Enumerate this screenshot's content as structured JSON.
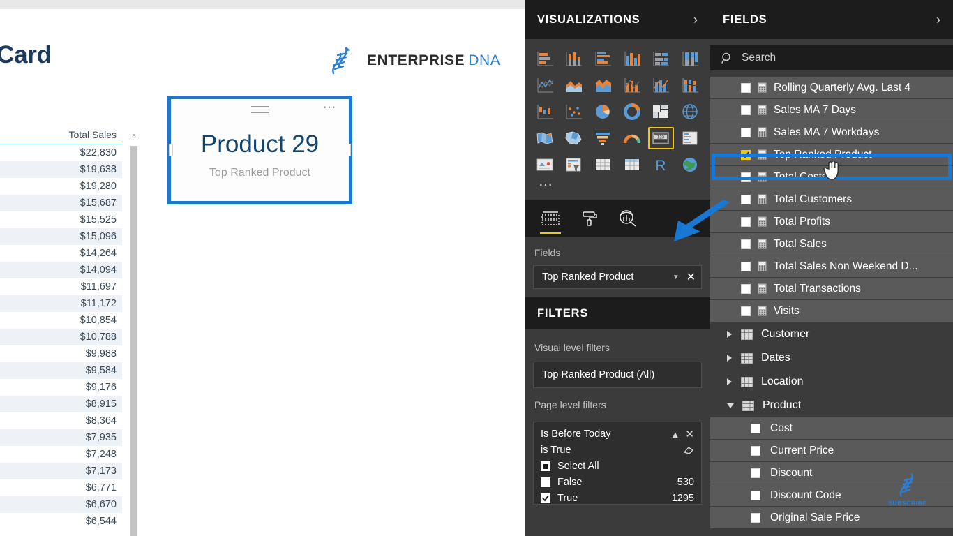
{
  "report": {
    "title": "A Card",
    "logo": {
      "primary": "ENTERPRISE",
      "secondary": "DNA",
      "icon": "dna-helix-icon"
    },
    "card_visual": {
      "value": "Product 29",
      "label": "Top Ranked Product",
      "focus_icon": "focus-mode-icon",
      "more_icon": "more-options-ellipsis-icon",
      "selected": true,
      "selection_color": "#1878d4"
    },
    "sales_table": {
      "header": "Total Sales",
      "values": [
        "$22,830",
        "$19,638",
        "$19,280",
        "$15,687",
        "$15,525",
        "$15,096",
        "$14,264",
        "$14,094",
        "$11,697",
        "$11,172",
        "$10,854",
        "$10,788",
        "$9,988",
        "$9,584",
        "$9,176",
        "$8,915",
        "$8,364",
        "$7,935",
        "$7,248",
        "$7,173",
        "$6,771",
        "$6,670",
        "$6,544"
      ],
      "scroll_up_icon": "chevron-up-icon"
    }
  },
  "visualizations": {
    "title": "VISUALIZATIONS",
    "expand_icon": "chevron-right-icon",
    "gallery": [
      {
        "name": "stacked-bar-chart",
        "selected": false
      },
      {
        "name": "stacked-column-chart",
        "selected": false
      },
      {
        "name": "clustered-bar-chart",
        "selected": false
      },
      {
        "name": "clustered-column-chart",
        "selected": false
      },
      {
        "name": "100-percent-stacked-bar-chart",
        "selected": false
      },
      {
        "name": "100-percent-stacked-column-chart",
        "selected": false
      },
      {
        "name": "line-chart",
        "selected": false
      },
      {
        "name": "area-chart",
        "selected": false
      },
      {
        "name": "stacked-area-chart",
        "selected": false
      },
      {
        "name": "line-stacked-column-chart",
        "selected": false
      },
      {
        "name": "line-clustered-column-chart",
        "selected": false
      },
      {
        "name": "ribbon-chart",
        "selected": false
      },
      {
        "name": "waterfall-chart",
        "selected": false
      },
      {
        "name": "scatter-chart",
        "selected": false
      },
      {
        "name": "pie-chart",
        "selected": false
      },
      {
        "name": "donut-chart",
        "selected": false
      },
      {
        "name": "treemap-chart",
        "selected": false
      },
      {
        "name": "map-visual",
        "selected": false
      },
      {
        "name": "filled-map-visual",
        "selected": false
      },
      {
        "name": "shape-map-visual",
        "selected": false
      },
      {
        "name": "funnel-chart",
        "selected": false
      },
      {
        "name": "gauge-chart",
        "selected": false
      },
      {
        "name": "card-visual",
        "selected": true
      },
      {
        "name": "multi-row-card-visual",
        "selected": false
      },
      {
        "name": "kpi-visual",
        "selected": false
      },
      {
        "name": "slicer-visual",
        "selected": false
      },
      {
        "name": "table-visual",
        "selected": false
      },
      {
        "name": "matrix-visual",
        "selected": false
      },
      {
        "name": "r-script-visual",
        "selected": false
      },
      {
        "name": "arcgis-map-visual",
        "selected": false
      }
    ],
    "more_visuals_icon": "ellipsis-icon",
    "tabs": [
      {
        "name": "fields-tab",
        "icon": "fields-pane-icon",
        "active": true
      },
      {
        "name": "format-tab",
        "icon": "paint-roller-icon",
        "active": false
      },
      {
        "name": "analytics-tab",
        "icon": "analytics-magnifier-icon",
        "active": false
      }
    ],
    "fields_well": {
      "title": "Fields",
      "chip": {
        "label": "Top Ranked Product",
        "dropdown_icon": "chevron-down-icon",
        "remove_icon": "close-x-icon"
      }
    }
  },
  "filters": {
    "title": "FILTERS",
    "visual_level_label": "Visual level filters",
    "visual_level_chip": "Top Ranked Product  (All)",
    "page_level_label": "Page level filters",
    "page_filter": {
      "field": "Is Before Today",
      "collapse_icon": "chevron-up-icon",
      "remove_icon": "close-x-icon",
      "condition": "is True",
      "clear_icon": "eraser-icon",
      "items": [
        {
          "label": "Select All",
          "count": "",
          "state": "partial"
        },
        {
          "label": "False",
          "count": "530",
          "state": "unchecked"
        },
        {
          "label": "True",
          "count": "1295",
          "state": "checked"
        }
      ]
    }
  },
  "fields": {
    "title": "FIELDS",
    "expand_icon": "chevron-right-icon",
    "search": {
      "placeholder": "Search",
      "icon": "search-icon",
      "value": ""
    },
    "measures": [
      {
        "label": "Rolling Quarterly Avg. Last 4",
        "checked": false,
        "highlighted": false
      },
      {
        "label": "Sales MA 7 Days",
        "checked": false,
        "highlighted": false
      },
      {
        "label": "Sales MA 7 Workdays",
        "checked": false,
        "highlighted": false
      },
      {
        "label": "Top Ranked Product",
        "checked": true,
        "highlighted": true
      },
      {
        "label": "Total Costs",
        "checked": false,
        "highlighted": false
      },
      {
        "label": "Total Customers",
        "checked": false,
        "highlighted": false
      },
      {
        "label": "Total Profits",
        "checked": false,
        "highlighted": false
      },
      {
        "label": "Total Sales",
        "checked": false,
        "highlighted": false
      },
      {
        "label": "Total Sales Non Weekend D...",
        "checked": false,
        "highlighted": false
      },
      {
        "label": "Total Transactions",
        "checked": false,
        "highlighted": false
      },
      {
        "label": "Visits",
        "checked": false,
        "highlighted": false
      }
    ],
    "tables": [
      {
        "label": "Customer",
        "expanded": false
      },
      {
        "label": "Dates",
        "expanded": false
      },
      {
        "label": "Location",
        "expanded": false
      },
      {
        "label": "Product",
        "expanded": true
      }
    ],
    "product_columns": [
      {
        "label": "Cost",
        "checked": false
      },
      {
        "label": "Current Price",
        "checked": false
      },
      {
        "label": "Discount",
        "checked": false
      },
      {
        "label": "Discount Code",
        "checked": false
      },
      {
        "label": "Original Sale Price",
        "checked": false
      }
    ],
    "row_more_icon": "more-options-ellipsis-icon",
    "cursor": "hand-pointer-cursor",
    "highlight_color": "#1878d4",
    "checkbox_color": "#f2c811"
  },
  "watermark": {
    "text": "SUBSCRIBE",
    "icon": "dna-helix-icon"
  },
  "annotation": {
    "arrow": "blue-arrow-pointing-to-fields-well",
    "color": "#1878d4"
  }
}
